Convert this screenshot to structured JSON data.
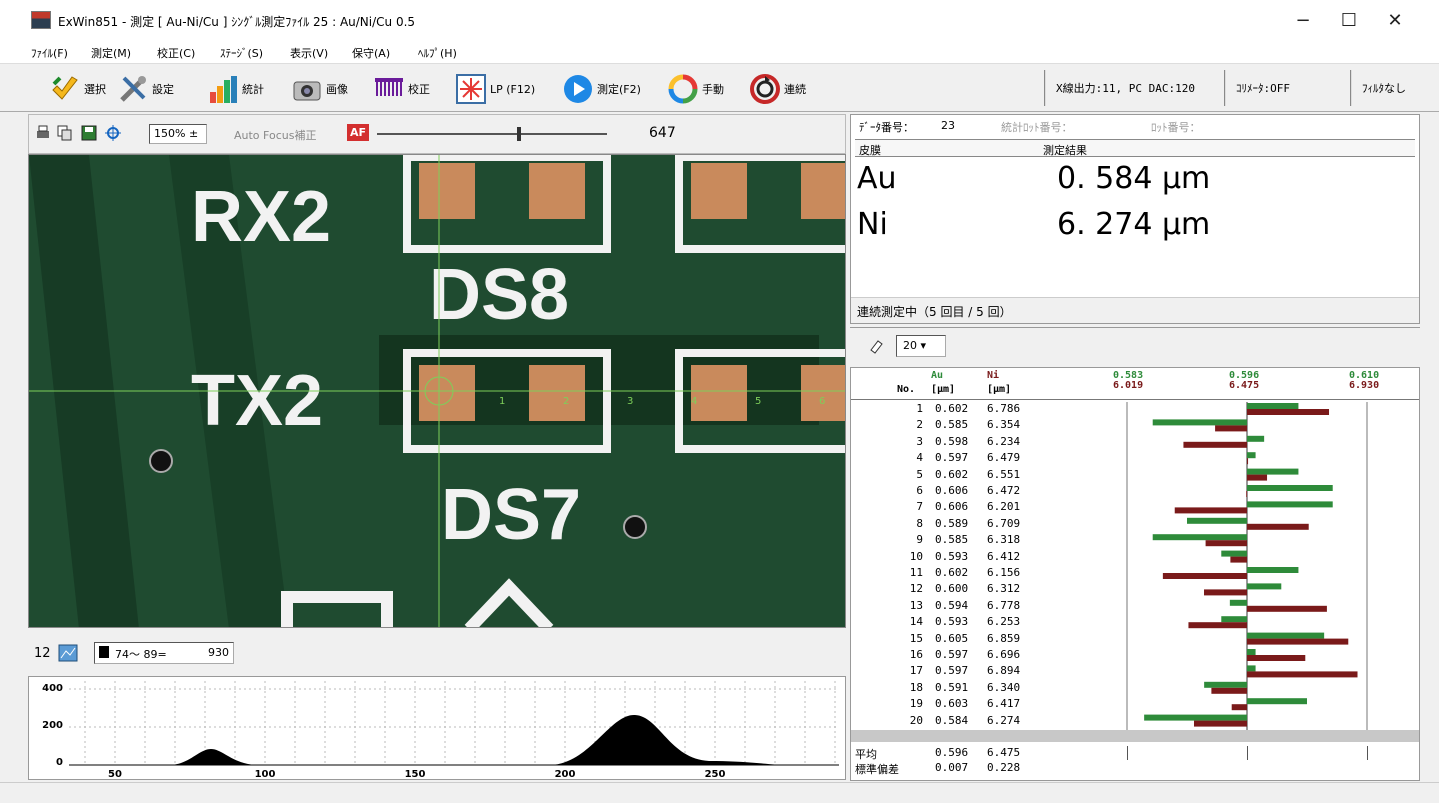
{
  "window": {
    "title": "ExWin851 - 測定 [ Au-Ni/Cu ] ｼﾝｸﾞﾙ測定ﾌｧｲﾙ 25 : Au/Ni/Cu 0.5",
    "minimize": "−",
    "maximize": "☐",
    "close": "✕"
  },
  "menu": [
    "ﾌｧｲﾙ(F)",
    "測定(M)",
    "校正(C)",
    "ｽﾃｰｼﾞ(S)",
    "表示(V)",
    "保守(A)",
    "ﾍﾙﾌﾟ(H)"
  ],
  "toolbar": {
    "buttons": [
      {
        "label": "選択",
        "icon": "check-arrow-icon"
      },
      {
        "label": "設定",
        "icon": "wrench-screwdriver-icon"
      },
      {
        "label": "統計",
        "icon": "bar-chart-icon"
      },
      {
        "label": "画像",
        "icon": "camera-icon"
      },
      {
        "label": "校正",
        "icon": "ruler-icon"
      },
      {
        "label": "LP (F12)",
        "icon": "laser-pointer-icon"
      },
      {
        "label": "測定(F2)",
        "icon": "play-icon"
      },
      {
        "label": "手動",
        "icon": "cycle-arrows-icon"
      },
      {
        "label": "連続",
        "icon": "repeat-icon"
      }
    ],
    "status": [
      "X線出力:11, PC DAC:120",
      "ｺﾘﾒｰﾀ:OFF",
      "ﾌｨﾙﾀなし"
    ]
  },
  "image_toolbar": {
    "zoom": "150%",
    "autofocus": "Auto Focus補正",
    "af_badge": "AF",
    "slider_value": "647"
  },
  "camera": {
    "labels": [
      "RX2",
      "DS8",
      "TX2",
      "DS7"
    ],
    "crosshair_ticks": [
      "1",
      "2",
      "3",
      "4",
      "5",
      "6"
    ]
  },
  "hist_toolbar": {
    "count": "12",
    "range": "74〜 89=",
    "value": "930"
  },
  "histogram": {
    "y_ticks": [
      "400",
      "200",
      "0"
    ],
    "x_ticks": [
      "50",
      "100",
      "150",
      "200",
      "250"
    ]
  },
  "info": {
    "data_number_label": "ﾃﾞｰﾀ番号：",
    "data_number": "23",
    "stats_lot_label": "統計ﾛｯﾄ番号：",
    "lot_label": "ﾛｯﾄ番号：",
    "col_layer": "皮膜",
    "col_result": "測定結果",
    "results": [
      {
        "name": "Au",
        "value": "0. 584 μm"
      },
      {
        "name": "Ni",
        "value": "6. 274 μm"
      }
    ],
    "status": "連続測定中（5 回目 / 5 回）"
  },
  "right_tools": {
    "count": "20"
  },
  "table": {
    "h_no": "No.",
    "h_au": "Au",
    "h_ni": "Ni",
    "h_unit": "[μm]",
    "scale_au": [
      "0.583",
      "0.596",
      "0.610"
    ],
    "scale_ni": [
      "6.019",
      "6.475",
      "6.930"
    ],
    "rows": [
      [
        "1",
        "0.602",
        "6.786"
      ],
      [
        "2",
        "0.585",
        "6.354"
      ],
      [
        "3",
        "0.598",
        "6.234"
      ],
      [
        "4",
        "0.597",
        "6.479"
      ],
      [
        "5",
        "0.602",
        "6.551"
      ],
      [
        "6",
        "0.606",
        "6.472"
      ],
      [
        "7",
        "0.606",
        "6.201"
      ],
      [
        "8",
        "0.589",
        "6.709"
      ],
      [
        "9",
        "0.585",
        "6.318"
      ],
      [
        "10",
        "0.593",
        "6.412"
      ],
      [
        "11",
        "0.602",
        "6.156"
      ],
      [
        "12",
        "0.600",
        "6.312"
      ],
      [
        "13",
        "0.594",
        "6.778"
      ],
      [
        "14",
        "0.593",
        "6.253"
      ],
      [
        "15",
        "0.605",
        "6.859"
      ],
      [
        "16",
        "0.597",
        "6.696"
      ],
      [
        "17",
        "0.597",
        "6.894"
      ],
      [
        "18",
        "0.591",
        "6.340"
      ],
      [
        "19",
        "0.603",
        "6.417"
      ],
      [
        "20",
        "0.584",
        "6.274"
      ]
    ],
    "mean_label": "平均",
    "mean_au": "0.596",
    "mean_ni": "6.475",
    "sd_label": "標準偏差",
    "sd_au": "0.007",
    "sd_ni": "0.228"
  },
  "colors": {
    "au": "#2e8b3a",
    "ni": "#7a1a1a",
    "board": "#1e4a2e",
    "pad": "#c98a5c"
  }
}
